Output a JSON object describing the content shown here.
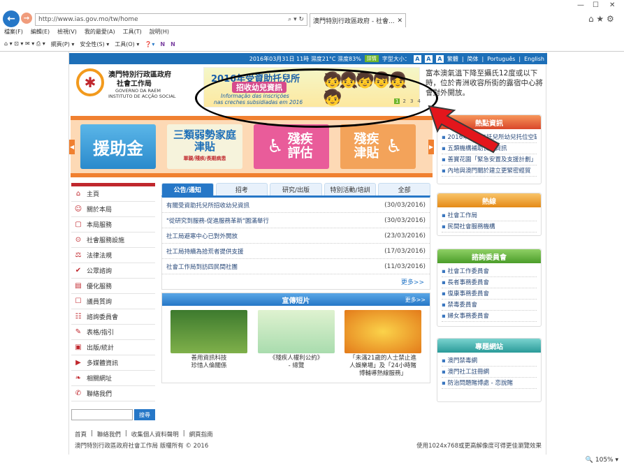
{
  "browser": {
    "url": "http://www.ias.gov.mo/tw/home",
    "tab_title": "澳門特別行政區政府 - 社會...",
    "menu": [
      "檔案(F)",
      "編輯(E)",
      "檢視(V)",
      "我的最愛(A)",
      "工具(T)",
      "說明(H)"
    ],
    "cmd": [
      "網頁(P) ▾",
      "安全性(S) ▾",
      "工具(O) ▾"
    ],
    "zoom": "105%"
  },
  "topbar": {
    "date": "2016年03月31日 11時 濕度21°C 濕度83%",
    "weather_badge": "詳情",
    "font_label": "字型大小：",
    "font_sizes": [
      "A",
      "A",
      "A"
    ],
    "langs": [
      "繁體",
      "简体",
      "Português",
      "English"
    ]
  },
  "logo": {
    "name_zh1": "澳門特別行政區政府",
    "name_zh2": "社會工作局",
    "name_pt1": "GOVERNO DA RAEM",
    "name_pt2": "INSTITUTO DE ACÇÃO SOCIAL"
  },
  "banner": {
    "line1": "2016年受資助托兒所",
    "line2": "招收幼兒資訊",
    "line3": "Informação das inscrições",
    "line4": "nas creches subsidiadas em 2016",
    "pages": [
      "1",
      "2",
      "3",
      "4"
    ]
  },
  "notice": "富本澳氣溫下降至攝氏12度或以下時，位於青洲收容所街的露宿中心將會對外開放。",
  "carousel": [
    "援助金",
    "三類弱勢家庭津貼",
    "殘疾評估",
    "殘疾津貼"
  ],
  "carousel_sub": "單親/殘疾/長期病患",
  "hot": {
    "title": "熱點資訊",
    "items": [
      "2016年下半年托兒所幼兒托位空缺",
      "五類機構補助食品資訊",
      "善寶花園「緊急安置及支援計劃」",
      "內地與澳門關於建立更緊密經貿"
    ]
  },
  "hotline": {
    "title": "熱線",
    "items": [
      "社會工作局",
      "民間社會服務機構"
    ]
  },
  "committee": {
    "title": "諮詢委員會",
    "items": [
      "社會工作委員會",
      "長者事務委員會",
      "復康事務委員會",
      "禁毒委員會",
      "婦女事務委員會"
    ]
  },
  "sites": {
    "title": "專題網站",
    "items": [
      "澳門禁毒網",
      "澳門社工註冊網",
      "防治問題賭博處 - 恋說賭"
    ]
  },
  "nav": [
    "主頁",
    "關於本局",
    "本局服務",
    "社會服務設施",
    "法律法規",
    "公眾諮詢",
    "優化服務",
    "議員質詢",
    "諮詢委員會",
    "表格/指引",
    "出版/統計",
    "多媒體資訊",
    "相關網址",
    "聯絡我們"
  ],
  "search_label": "搜尋",
  "tabs": [
    "公告/通知",
    "招考",
    "研究/出版",
    "特別活動/培訓",
    "全部"
  ],
  "news": [
    {
      "t": "有關受資助托兒所招收幼兒資訊",
      "d": "(30/03/2016)"
    },
    {
      "t": "\"從研究到服務-促進服務革新\"圓滿舉行",
      "d": "(30/03/2016)"
    },
    {
      "t": "社工局避寒中心已對外開放",
      "d": "(23/03/2016)"
    },
    {
      "t": "社工局持續為拾荒者提供支援",
      "d": "(17/03/2016)"
    },
    {
      "t": "社會工作局到訪四民間社團",
      "d": "(11/03/2016)"
    }
  ],
  "more": "更多>>",
  "videos": {
    "title": "宣傳短片",
    "more": "更多>>",
    "items": [
      "善用資訊科技\n珍惜人倫關係",
      "《殘疾人權利公約》\n- 總覽",
      "「未滿21歲的人士禁止進\n人娛樂場」及「24小時賭\n博輔導熱線服務」"
    ]
  },
  "footer": {
    "links": [
      "首頁",
      "聯絡我們",
      "收集個人資料聲明",
      "網頁指南"
    ],
    "copyright": "澳門特別行政區政府社會工作局 版權所有 © 2016",
    "res": "使用1024x768或更高解像度可得更佳瀏覽效果"
  }
}
